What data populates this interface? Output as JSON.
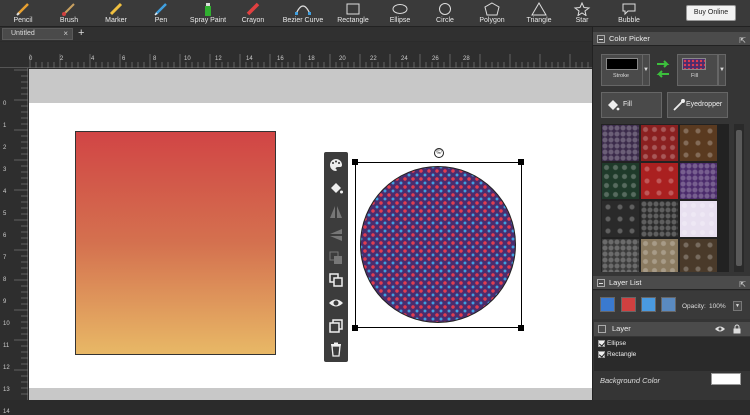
{
  "toolbar": {
    "tools": [
      {
        "id": "pencil",
        "label": "Pencil",
        "icon": "pencil-icon"
      },
      {
        "id": "brush",
        "label": "Brush",
        "icon": "brush-icon"
      },
      {
        "id": "marker",
        "label": "Marker",
        "icon": "marker-icon"
      },
      {
        "id": "pen",
        "label": "Pen",
        "icon": "pen-icon"
      },
      {
        "id": "spray",
        "label": "Spray Paint",
        "icon": "spray-paint-icon"
      },
      {
        "id": "crayon",
        "label": "Crayon",
        "icon": "crayon-icon"
      },
      {
        "id": "bezier",
        "label": "Bezier Curve",
        "icon": "bezier-curve-icon"
      },
      {
        "id": "rectangle",
        "label": "Rectangle",
        "icon": "rectangle-icon"
      },
      {
        "id": "ellipse",
        "label": "Ellipse",
        "icon": "ellipse-icon"
      },
      {
        "id": "circle",
        "label": "Circle",
        "icon": "circle-icon"
      },
      {
        "id": "polygon",
        "label": "Polygon",
        "icon": "polygon-icon"
      },
      {
        "id": "triangle",
        "label": "Triangle",
        "icon": "triangle-icon"
      },
      {
        "id": "star",
        "label": "Star",
        "icon": "star-icon"
      },
      {
        "id": "bubble",
        "label": "Bubble",
        "icon": "bubble-icon"
      }
    ],
    "buy_label": "Buy Online"
  },
  "tabs": {
    "doc_title": "Untitled",
    "close_symbol": "×",
    "add_symbol": "+"
  },
  "ruler": {
    "h_numbers": [
      "0",
      "2",
      "4",
      "6",
      "8",
      "10",
      "12",
      "14",
      "16",
      "18",
      "20",
      "22",
      "24",
      "26",
      "28"
    ],
    "v_numbers": [
      "0",
      "1",
      "2",
      "3",
      "4",
      "5",
      "6",
      "7",
      "8",
      "9",
      "10",
      "11",
      "12",
      "13",
      "14"
    ]
  },
  "canvas": {
    "rotate_symbol": "©",
    "rect_gradient": [
      "#d14545",
      "#d4714f",
      "#e8b866"
    ],
    "ellipse_pattern_colors": [
      "#4a2d6e",
      "#e33d4f",
      "#3fa0e0"
    ]
  },
  "context_toolbar": {
    "buttons": [
      "palette-icon",
      "fill-bucket-icon",
      "flip-horizontal-icon",
      "flip-vertical-icon",
      "arrange-icon",
      "group-icon",
      "visibility-icon",
      "duplicate-icon",
      "delete-icon"
    ]
  },
  "color_picker": {
    "title": "Color Picker",
    "stroke_label": "Stroke",
    "fill_label": "Fill",
    "fill_button": "Fill",
    "eyedropper_button": "Eyedropper",
    "dropdown_symbol": "▼",
    "stroke_color": "#000000"
  },
  "patterns": {
    "colors": [
      [
        "#3a2a4a",
        "#8a2020",
        "#5a3a20"
      ],
      [
        "#1f3a2a",
        "#aa2020",
        "#4a2a6a"
      ],
      [
        "#2a2a2a",
        "#2a2a2a",
        "#e8e0f0"
      ],
      [
        "#3a3a3a",
        "#8a7a60",
        "#4a3a2a"
      ]
    ]
  },
  "layer_list": {
    "title": "Layer List",
    "opacity_label": "Opacity:",
    "opacity_value": "100%",
    "group_label": "Layer",
    "layers": [
      {
        "name": "Ellipse",
        "checked": true
      },
      {
        "name": "Rectangle",
        "checked": true
      }
    ],
    "background_label": "Background Color",
    "background_color": "#ffffff"
  }
}
